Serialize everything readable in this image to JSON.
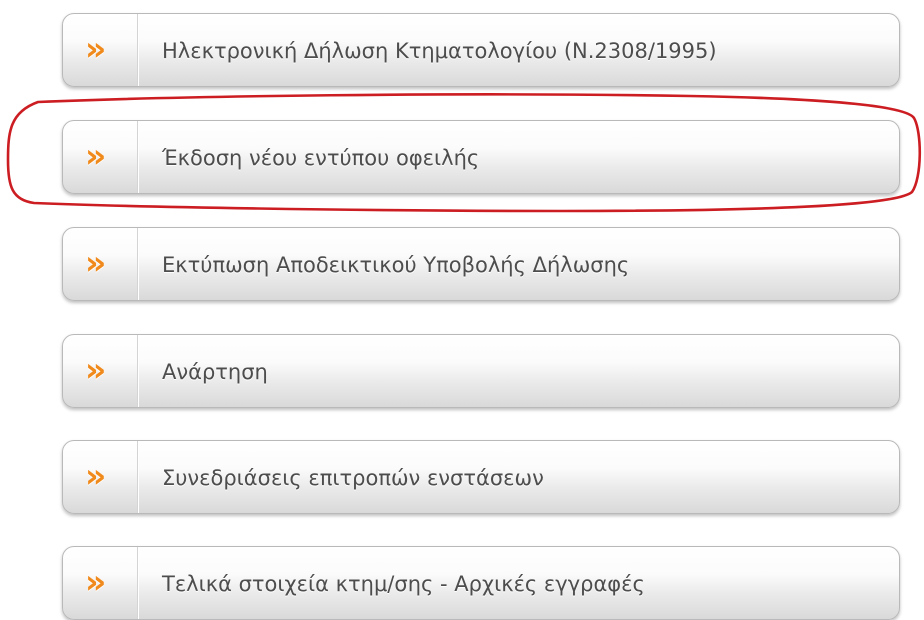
{
  "menu": {
    "items": [
      {
        "label": "Ηλεκτρονική Δήλωση Κτηματολογίου (Ν.2308/1995)",
        "icon": "double-chevron-right-icon"
      },
      {
        "label": "Έκδοση νέου εντύπου οφειλής",
        "icon": "double-chevron-right-icon"
      },
      {
        "label": "Εκτύπωση Αποδεικτικού Υποβολής Δήλωσης",
        "icon": "double-chevron-right-icon"
      },
      {
        "label": "Ανάρτηση",
        "icon": "double-chevron-right-icon"
      },
      {
        "label": "Συνεδριάσεις επιτροπών ενστάσεων",
        "icon": "double-chevron-right-icon"
      },
      {
        "label": "Τελικά στοιχεία κτημ/σης - Αρχικές εγγραφές",
        "icon": "double-chevron-right-icon"
      }
    ]
  },
  "icon_glyph": "»",
  "colors": {
    "accent_orange": "#f08a1c",
    "label_text": "#4d4d4d",
    "highlight_red": "#cc1d22",
    "button_border": "#b9b9b9"
  }
}
